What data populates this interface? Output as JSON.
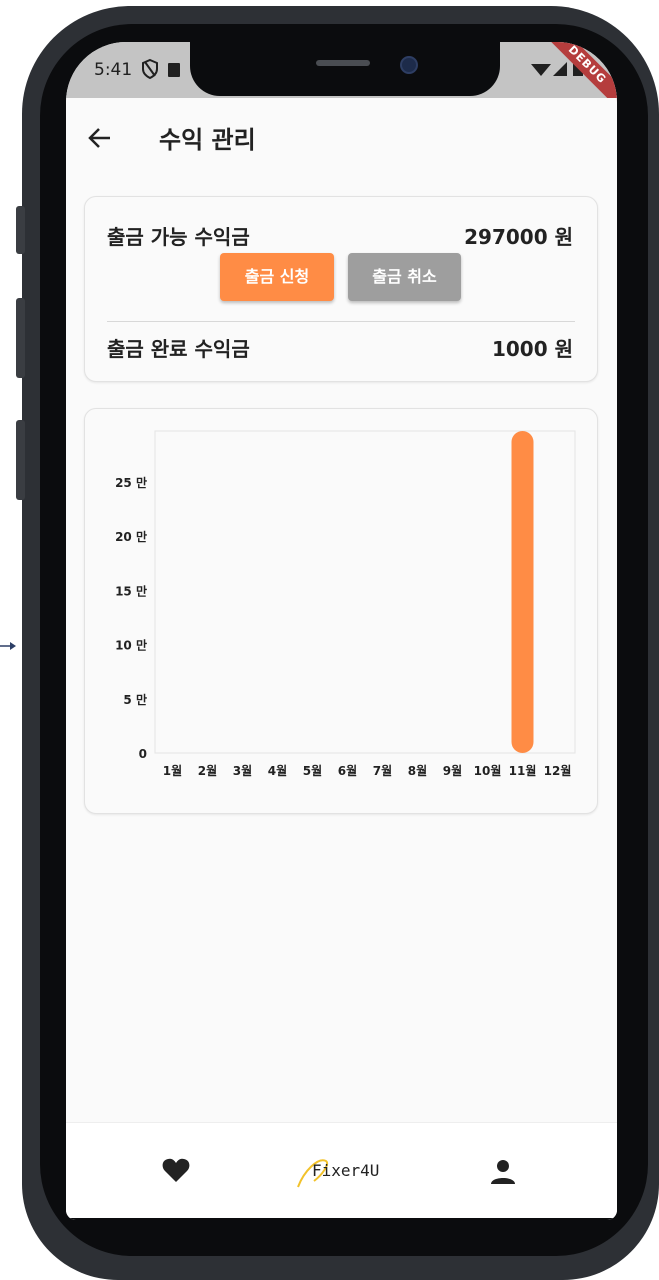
{
  "status_bar": {
    "time": "5:41",
    "debug_label": "DEBUG"
  },
  "header": {
    "title": "수익 관리"
  },
  "earnings": {
    "available_label": "출금 가능 수익금",
    "available_value": "297000 원",
    "withdraw_button": "출금 신청",
    "cancel_button": "출금 취소",
    "completed_label": "출금 완료 수익금",
    "completed_value": "1000 원"
  },
  "chart_data": {
    "type": "bar",
    "title": "",
    "xlabel": "",
    "ylabel": "",
    "categories": [
      "1월",
      "2월",
      "3월",
      "4월",
      "5월",
      "6월",
      "7월",
      "8월",
      "9월",
      "10월",
      "11월",
      "12월"
    ],
    "values": [
      0,
      0,
      0,
      0,
      0,
      0,
      0,
      0,
      0,
      0,
      297000,
      0
    ],
    "ylim": [
      0,
      297000
    ],
    "yticks": [
      0,
      50000,
      100000,
      150000,
      200000,
      250000
    ],
    "ytick_labels": [
      "0",
      "5 만",
      "10 만",
      "15 만",
      "20 만",
      "25 만"
    ],
    "grid": false,
    "bar_color": "#ff8c45"
  },
  "bottom_nav": {
    "left_icon": "heart-icon",
    "center_logo": "Fixer4U",
    "right_icon": "person-icon"
  },
  "colors": {
    "accent": "#ff8c45",
    "cancel_grey": "#9e9e9e",
    "logo_mark": "#f2c22b"
  }
}
